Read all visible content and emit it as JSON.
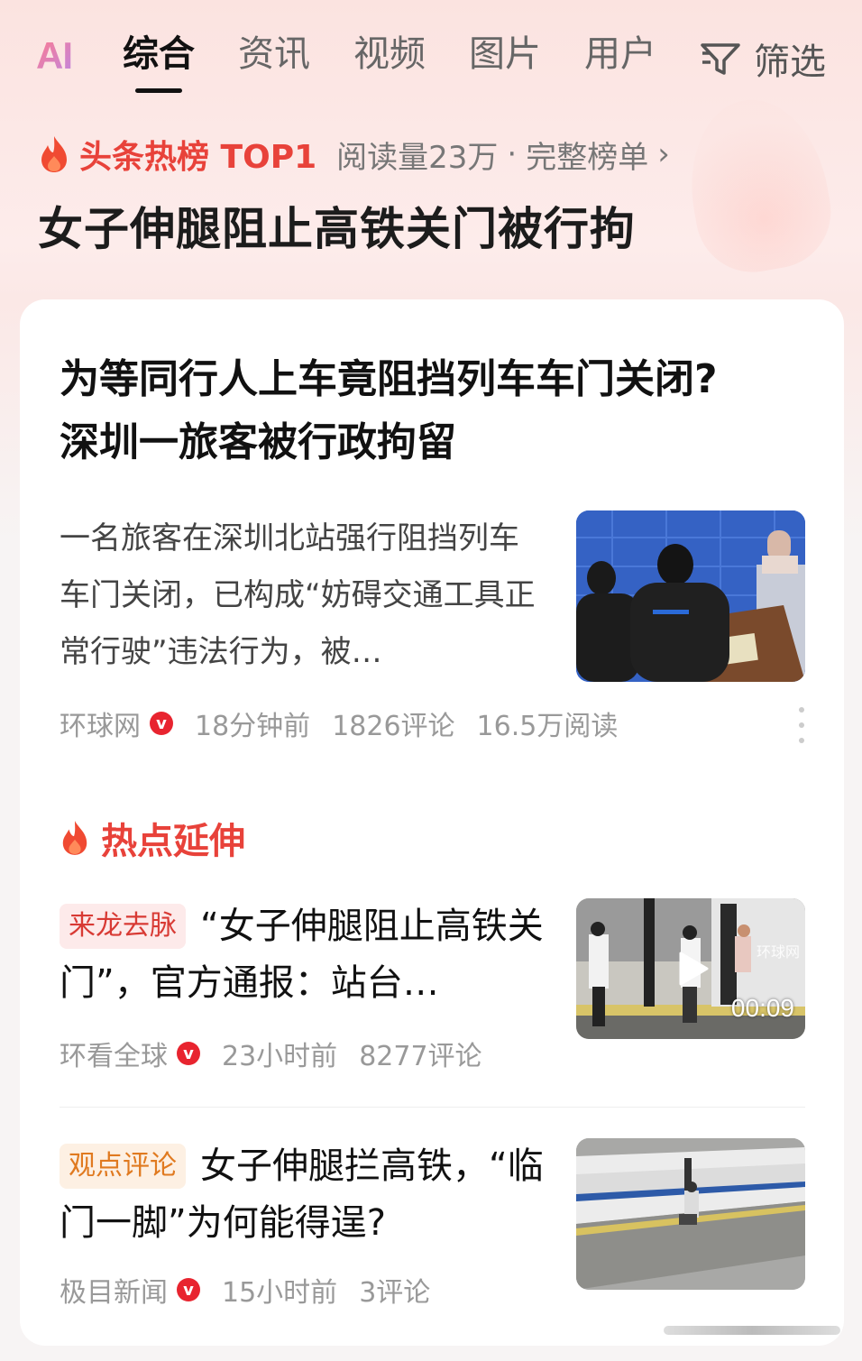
{
  "tabs": {
    "ai_label": "AI",
    "items": [
      "综合",
      "资讯",
      "视频",
      "图片",
      "用户"
    ],
    "filter_label": "筛选"
  },
  "hot_list": {
    "badge": "头条热榜 TOP1",
    "reads": "阅读量23万",
    "separator": "·",
    "full_list_link": "完整榜单",
    "arrow": "›",
    "headline": "女子伸腿阻止高铁关门被行拘"
  },
  "main_article": {
    "title_line1": "为等同行人上车竟阻挡列车车门关闭?",
    "title_line2": "深圳一旅客被行政拘留",
    "summary": "一名旅客在深圳北站强行阻挡列车车门关闭，已构成“妨碍交通工具正常行驶”违法行为，被…",
    "source": "环球网",
    "verified": "v",
    "time": "18分钟前",
    "comments": "1826评论",
    "reads": "16.5万阅读"
  },
  "section": {
    "title": "热点延伸"
  },
  "related": [
    {
      "tag": "来龙去脉",
      "title": "“女子伸腿阻止高铁关门”，官方通报：站台…",
      "source": "环看全球",
      "verified": "v",
      "time": "23小时前",
      "comments": "8277评论",
      "duration": "00:09",
      "watermark": "环球网"
    },
    {
      "tag": "观点评论",
      "title": "女子伸腿拦高铁，“临门一脚”为何能得逞?",
      "source": "极目新闻",
      "verified": "v",
      "time": "15小时前",
      "comments": "3评论"
    }
  ],
  "colors": {
    "accent_red": "#e8423a",
    "verified_red": "#e8242f",
    "tag_orange": "#e07a20"
  }
}
